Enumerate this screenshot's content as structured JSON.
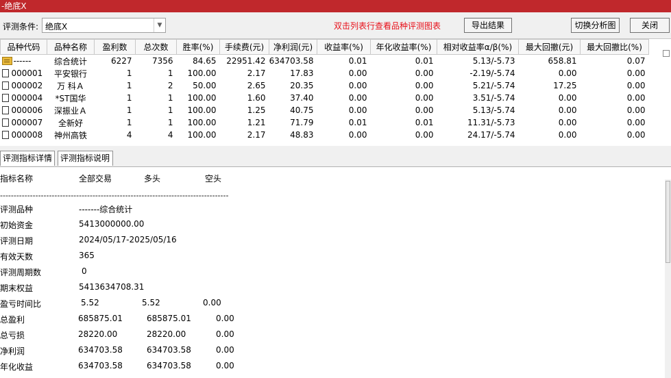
{
  "window": {
    "title": "-绝底X"
  },
  "toolbar": {
    "condition_label": "评测条件:",
    "condition_value": "绝底X",
    "hint": "双击列表行查看品种评测图表",
    "export_label": "导出结果",
    "switch_label": "切换分析图",
    "close_label": "关闭"
  },
  "grid": {
    "columns": [
      "品种代码",
      "品种名称",
      "盈利数",
      "总次数",
      "胜率(%)",
      "手续费(元)",
      "净利润(元)",
      "收益率(%)",
      "年化收益率(%)",
      "相对收益率α/β(%)",
      "最大回撤(元)",
      "最大回撤比(%)"
    ],
    "rows": [
      {
        "icon": "folder-icon",
        "cells": [
          "------",
          "综合统计",
          "6227",
          "7356",
          "84.65",
          "22951.42",
          "634703.58",
          "0.01",
          "0.01",
          "5.13/-5.73",
          "658.81",
          "0.07"
        ]
      },
      {
        "icon": "document-icon",
        "cells": [
          "000001",
          "平安银行",
          "1",
          "1",
          "100.00",
          "2.17",
          "17.83",
          "0.00",
          "0.00",
          "-2.19/-5.74",
          "0.00",
          "0.00"
        ]
      },
      {
        "icon": "document-icon",
        "cells": [
          "000002",
          "万 科Ａ",
          "1",
          "2",
          "50.00",
          "2.65",
          "20.35",
          "0.00",
          "0.00",
          "5.21/-5.74",
          "17.25",
          "0.00"
        ]
      },
      {
        "icon": "document-icon",
        "cells": [
          "000004",
          "*ST国华",
          "1",
          "1",
          "100.00",
          "1.60",
          "37.40",
          "0.00",
          "0.00",
          "3.51/-5.74",
          "0.00",
          "0.00"
        ]
      },
      {
        "icon": "document-icon",
        "cells": [
          "000006",
          "深振业Ａ",
          "1",
          "1",
          "100.00",
          "1.25",
          "40.75",
          "0.00",
          "0.00",
          "5.13/-5.74",
          "0.00",
          "0.00"
        ]
      },
      {
        "icon": "document-icon",
        "cells": [
          "000007",
          "全新好",
          "1",
          "1",
          "100.00",
          "1.21",
          "71.79",
          "0.01",
          "0.01",
          "11.31/-5.73",
          "0.00",
          "0.00"
        ]
      },
      {
        "icon": "document-icon",
        "cells": [
          "000008",
          "神州高铁",
          "4",
          "4",
          "100.00",
          "2.17",
          "48.83",
          "0.00",
          "0.00",
          "24.17/-5.74",
          "0.00",
          "0.00"
        ]
      }
    ]
  },
  "tabs": {
    "detail": "评测指标详情",
    "explain": "评测指标说明"
  },
  "detail": {
    "header": {
      "name": "指标名称",
      "all": "全部交易",
      "long": "多头",
      "short": "空头"
    },
    "separator": "------------------------------------------------------------------------------------",
    "rows": [
      {
        "label": "评测品种",
        "all": "-------综合统计",
        "long": "",
        "short": ""
      },
      {
        "label": "初始资金",
        "all": "5413000000.00",
        "long": "",
        "short": ""
      },
      {
        "label": "评测日期",
        "all": "2024/05/17-2025/05/16",
        "long": "",
        "short": ""
      },
      {
        "label": "有效天数",
        "all": "365",
        "long": "",
        "short": ""
      },
      {
        "label": "评测周期数",
        "all": "0",
        "long": "",
        "short": ""
      },
      {
        "label": "期末权益",
        "all": "5413634708.31",
        "long": "",
        "short": ""
      },
      {
        "label": "盈亏时间比",
        "all": "5.52",
        "long": "5.52",
        "short": "0.00"
      },
      {
        "label": "总盈利",
        "all": "685875.01",
        "long": "685875.01",
        "short": "0.00"
      },
      {
        "label": "总亏损",
        "all": "28220.00",
        "long": "28220.00",
        "short": "0.00"
      },
      {
        "label": "净利润",
        "all": "634703.58",
        "long": "634703.58",
        "short": "0.00"
      },
      {
        "label": "年化收益",
        "all": "634703.58",
        "long": "634703.58",
        "short": "0.00"
      }
    ]
  }
}
